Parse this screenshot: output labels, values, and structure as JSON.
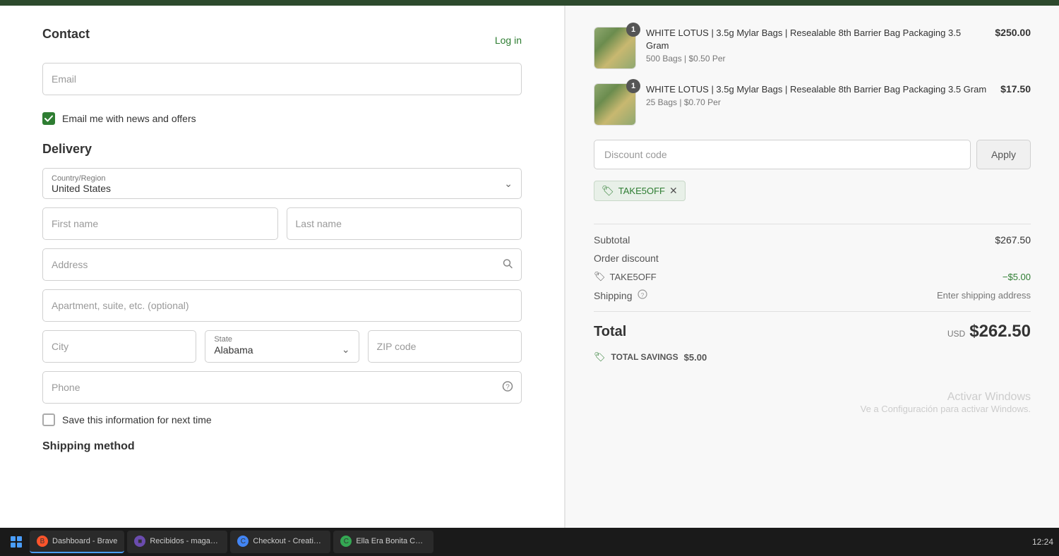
{
  "page": {
    "title": "Checkout - Creative L..."
  },
  "contact": {
    "section_label": "Contact",
    "log_in_label": "Log in",
    "email_placeholder": "Email",
    "checkbox_label": "Email me with news and offers"
  },
  "delivery": {
    "section_label": "Delivery",
    "country_region_label": "Country/Region",
    "country_value": "United States",
    "first_name_placeholder": "First name",
    "last_name_placeholder": "Last name",
    "address_placeholder": "Address",
    "apartment_placeholder": "Apartment, suite, etc. (optional)",
    "city_placeholder": "City",
    "state_label": "State",
    "state_value": "Alabama",
    "zip_placeholder": "ZIP code",
    "phone_placeholder": "Phone",
    "save_info_label": "Save this information for next time"
  },
  "shipping": {
    "section_label": "Shipping method"
  },
  "order_summary": {
    "products": [
      {
        "name": "WHITE LOTUS | 3.5g Mylar Bags | Resealable 8th Barrier Bag Packaging 3.5 Gram",
        "variant": "500 Bags | $0.50 Per",
        "price": "$250.00",
        "badge": "1"
      },
      {
        "name": "WHITE LOTUS | 3.5g Mylar Bags | Resealable 8th Barrier Bag Packaging 3.5 Gram",
        "variant": "25 Bags | $0.70 Per",
        "price": "$17.50",
        "badge": "1"
      }
    ],
    "discount_placeholder": "Discount code",
    "apply_label": "Apply",
    "coupon_code": "TAKE5OFF",
    "subtotal_label": "Subtotal",
    "subtotal_value": "$267.50",
    "order_discount_label": "Order discount",
    "discount_code_label": "TAKE5OFF",
    "discount_value": "−$5.00",
    "shipping_label": "Shipping",
    "shipping_value": "Enter shipping address",
    "total_label": "Total",
    "total_currency": "USD",
    "total_value": "$262.50",
    "savings_label": "TOTAL SAVINGS",
    "savings_value": "$5.00"
  },
  "watermark": {
    "main": "Activar Windows",
    "sub": "Ve a Configuración para activar Windows."
  },
  "taskbar": {
    "items": [
      {
        "label": "Dashboard - Brave",
        "icon_type": "brave",
        "active": true
      },
      {
        "label": "Recibidos - magapro...",
        "icon_type": "shield",
        "active": false
      },
      {
        "label": "Checkout - Creative L...",
        "icon_type": "chrome1",
        "active": false
      },
      {
        "label": "Ella Era Bonita Capitul...",
        "icon_type": "chrome2",
        "active": false
      }
    ],
    "time": "12:24"
  }
}
